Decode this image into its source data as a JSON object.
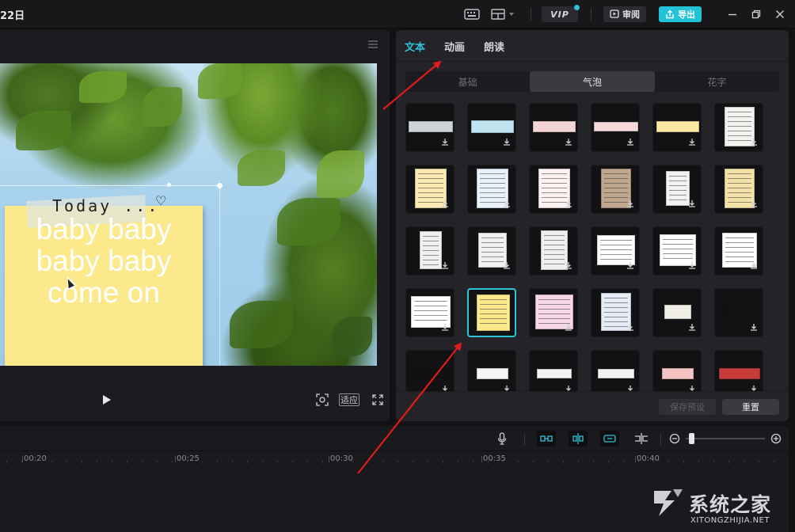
{
  "titlebar": {
    "title": "22日",
    "vip_label": "VIP",
    "review_label": "审阅",
    "export_label": "导出",
    "icons": [
      "keyboard-icon",
      "layout-icon",
      "minimize-icon",
      "maximize-icon",
      "close-icon"
    ]
  },
  "preview": {
    "overlay_title": "Today ...",
    "overlay_text": "baby baby baby baby come on",
    "fit_label": "适应"
  },
  "rpanel": {
    "tabs": [
      "文本",
      "动画",
      "朗读"
    ],
    "active_tab": "文本",
    "subtabs": [
      "基础",
      "气泡",
      "花字"
    ],
    "active_subtab": "气泡",
    "preset_label": "保存预设",
    "reset_label": "重置",
    "selected_tile_index": 19
  },
  "timeline": {
    "ticks": [
      "00:20",
      "00:25",
      "00:30",
      "00:35",
      "00:40"
    ]
  },
  "watermark": {
    "text": "系统之家",
    "sub": "XITONGZHIJIA.NET"
  },
  "colors": {
    "accent": "#2ec4d9",
    "annotation_arrow": "#e11b1b",
    "sticky_note": "#fbe98b"
  }
}
